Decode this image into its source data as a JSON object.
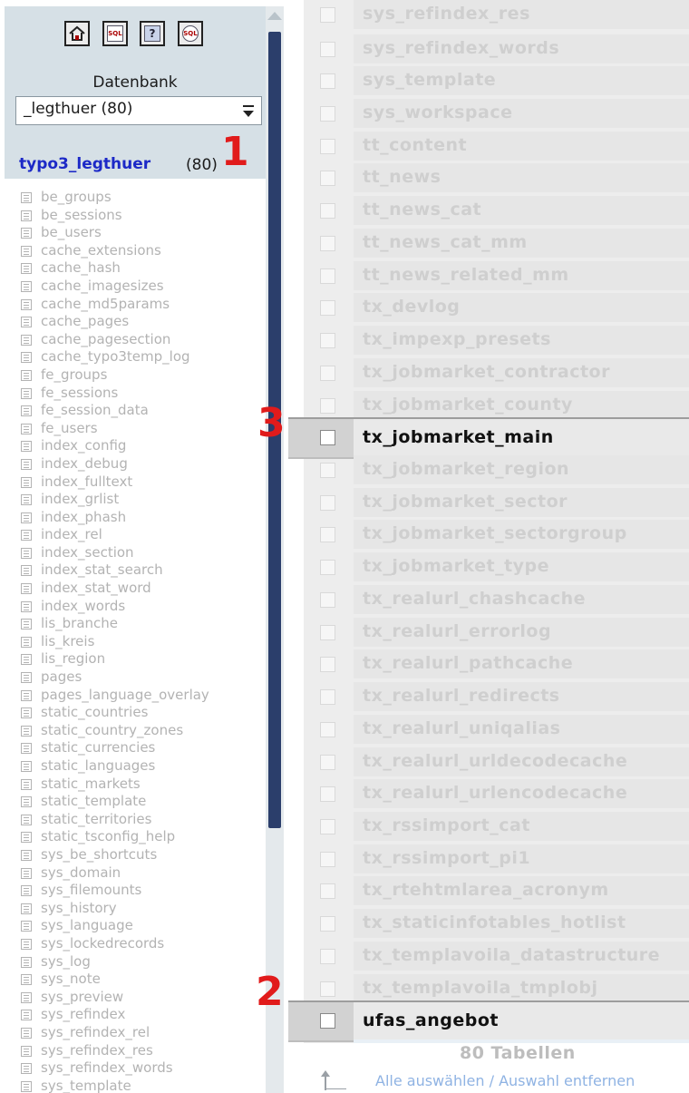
{
  "left_panel": {
    "toolbar": [
      {
        "name": "home-icon",
        "label": ""
      },
      {
        "name": "sql-icon",
        "label": "SQL"
      },
      {
        "name": "query-window-icon",
        "label": "?"
      },
      {
        "name": "sql-docs-icon",
        "label": "SQL"
      }
    ],
    "database_label": "Datenbank",
    "database_select_value": "_legthuer (80)",
    "current_db_link": "typo3_legthuer",
    "current_db_count": "(80)",
    "tables": [
      "be_groups",
      "be_sessions",
      "be_users",
      "cache_extensions",
      "cache_hash",
      "cache_imagesizes",
      "cache_md5params",
      "cache_pages",
      "cache_pagesection",
      "cache_typo3temp_log",
      "fe_groups",
      "fe_sessions",
      "fe_session_data",
      "fe_users",
      "index_config",
      "index_debug",
      "index_fulltext",
      "index_grlist",
      "index_phash",
      "index_rel",
      "index_section",
      "index_stat_search",
      "index_stat_word",
      "index_words",
      "lis_branche",
      "lis_kreis",
      "lis_region",
      "pages",
      "pages_language_overlay",
      "static_countries",
      "static_country_zones",
      "static_currencies",
      "static_languages",
      "static_markets",
      "static_template",
      "static_territories",
      "static_tsconfig_help",
      "sys_be_shortcuts",
      "sys_domain",
      "sys_filemounts",
      "sys_history",
      "sys_language",
      "sys_lockedrecords",
      "sys_log",
      "sys_note",
      "sys_preview",
      "sys_refindex",
      "sys_refindex_rel",
      "sys_refindex_res",
      "sys_refindex_words",
      "sys_template"
    ]
  },
  "right_panel": {
    "rows": [
      "sys_refindex_res",
      "sys_refindex_words",
      "sys_template",
      "sys_workspace",
      "tt_content",
      "tt_news",
      "tt_news_cat",
      "tt_news_cat_mm",
      "tt_news_related_mm",
      "tx_devlog",
      "tx_impexp_presets",
      "tx_jobmarket_contractor",
      "tx_jobmarket_county",
      "tx_jobmarket_main",
      "tx_jobmarket_region",
      "tx_jobmarket_sector",
      "tx_jobmarket_sectorgroup",
      "tx_jobmarket_type",
      "tx_realurl_chashcache",
      "tx_realurl_errorlog",
      "tx_realurl_pathcache",
      "tx_realurl_redirects",
      "tx_realurl_uniqalias",
      "tx_realurl_urldecodecache",
      "tx_realurl_urlencodecache",
      "tx_rssimport_cat",
      "tx_rssimport_pi1",
      "tx_rtehtmlarea_acronym",
      "tx_staticinfotables_hotlist",
      "tx_templavoila_datastructure",
      "tx_templavoila_tmplobj",
      "ufas_angebot"
    ],
    "highlighted": [
      "tx_jobmarket_main",
      "ufas_angebot"
    ],
    "footer_count": "80 Tabellen",
    "select_all": "Alle auswählen / Auswahl entfernen"
  },
  "annotations": {
    "mark_1": "1",
    "mark_2": "2",
    "mark_3": "3"
  },
  "colors": {
    "link_blue": "#1c29c7",
    "annotation_red": "#e11b1b",
    "scroll_thumb": "#2b3e6b"
  }
}
